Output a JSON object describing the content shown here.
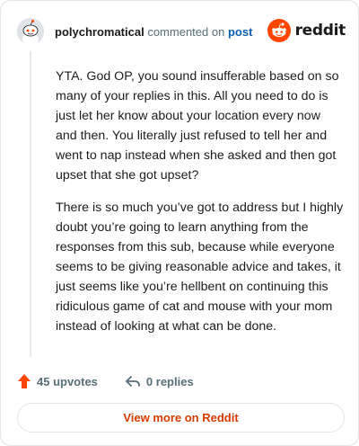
{
  "header": {
    "username": "polychromatical",
    "commented_on": "commented on",
    "post_link": "post",
    "brand": "reddit"
  },
  "comment": {
    "paragraphs": [
      "YTA. God OP, you sound insufferable based on so many of your replies in this. All you need to do is just let her know about your location every now and then. You literally just refused to tell her and went to nap instead when she asked and then got upset that she got upset?",
      "There is so much you’ve got to address but I highly doubt you’re going to learn anything from the responses from this sub, because while everyone seems to be giving reasonable advice and takes, it just seems like you’re hellbent on continuing this ridiculous game of cat and mouse with your mom instead of looking at what can be done."
    ]
  },
  "actions": {
    "upvotes": "45 upvotes",
    "replies": "0 replies"
  },
  "footer": {
    "view_more": "View more on Reddit"
  },
  "colors": {
    "brand_orange": "#ff4500",
    "link_blue": "#0a5fb4",
    "view_more_text": "#d93a00"
  },
  "icons": {
    "avatar": "snoo-avatar-icon",
    "brand": "reddit-logo-icon",
    "upvote": "upvote-arrow-icon",
    "reply": "reply-arrow-icon"
  }
}
